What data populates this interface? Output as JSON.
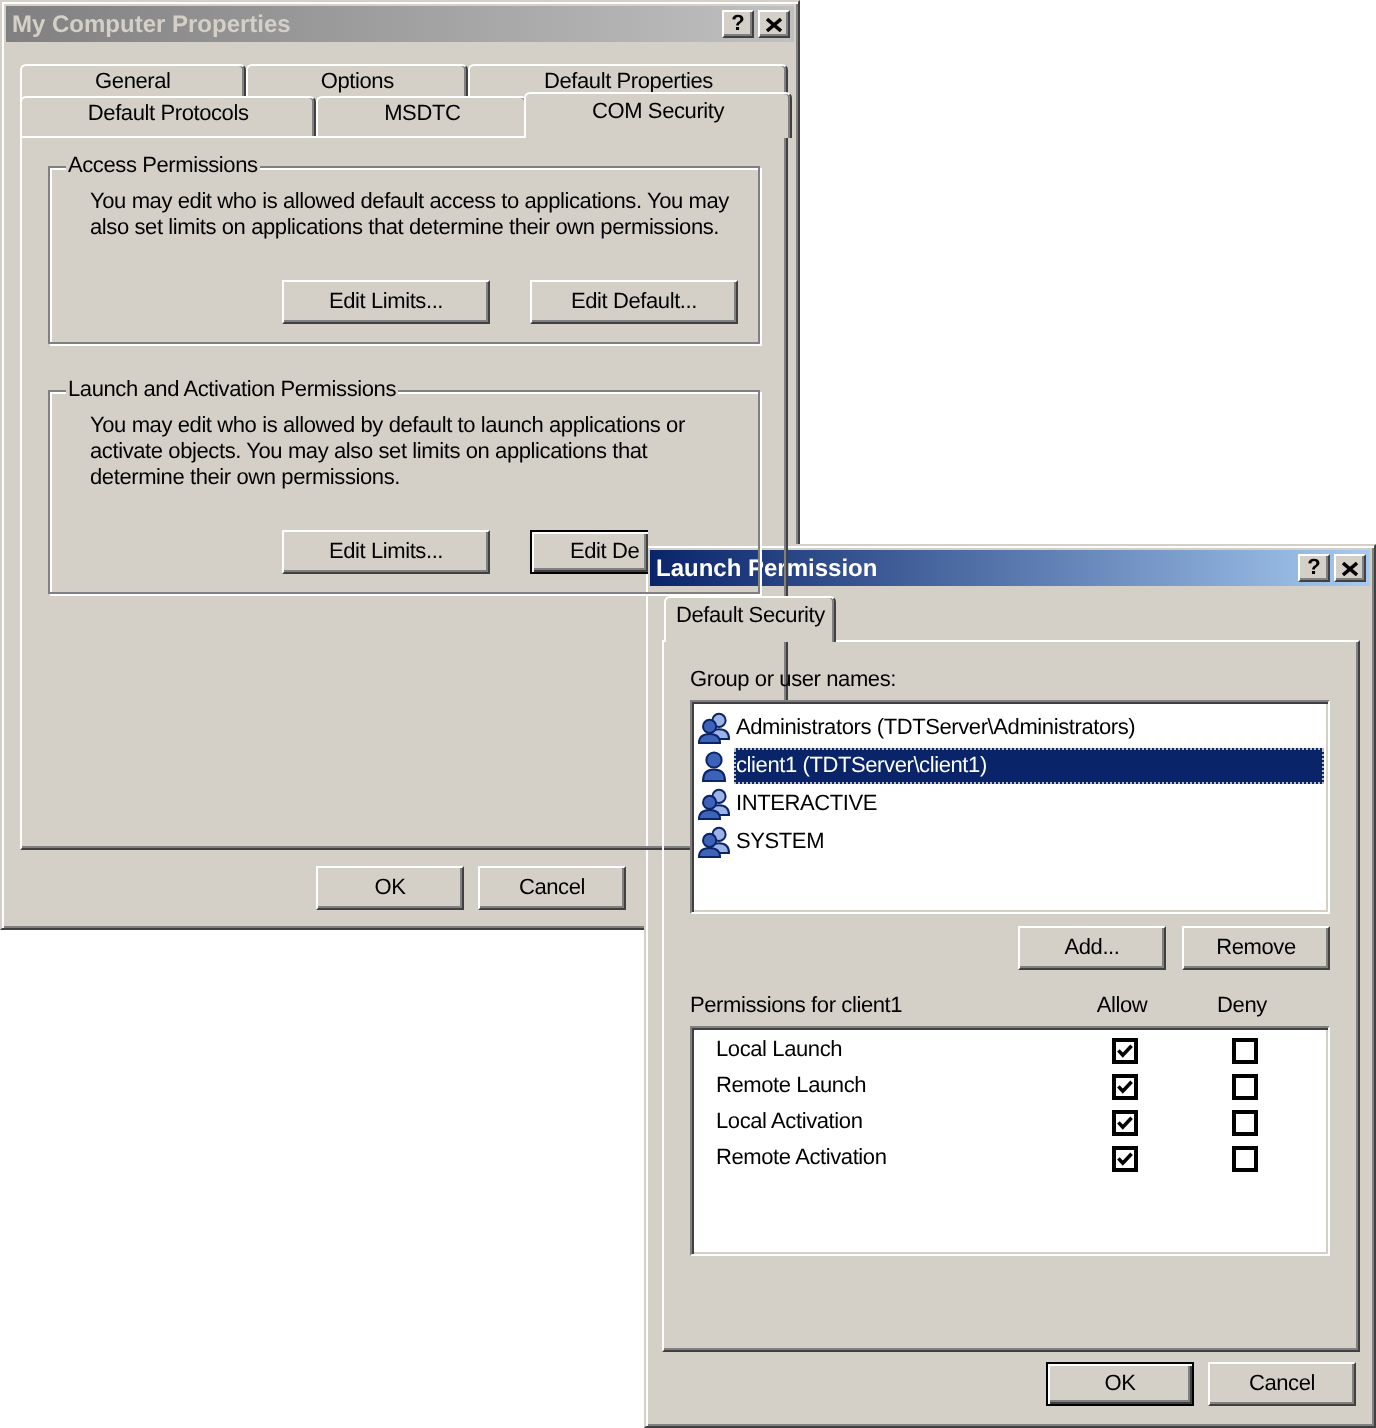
{
  "properties_window": {
    "title": "My Computer Properties",
    "active": false,
    "help_button": "?",
    "tab_rows": [
      [
        {
          "label": "General",
          "selected": false
        },
        {
          "label": "Options",
          "selected": false
        },
        {
          "label": "Default Properties",
          "selected": false
        }
      ],
      [
        {
          "label": "Default Protocols",
          "selected": false
        },
        {
          "label": "MSDTC",
          "selected": false
        },
        {
          "label": "COM Security",
          "selected": true
        }
      ]
    ],
    "groups": [
      {
        "legend": "Access Permissions",
        "text": "You may edit who is allowed default access to applications. You may also set limits on applications that determine their own permissions.",
        "buttons": [
          {
            "label": "Edit Limits...",
            "default": false
          },
          {
            "label": "Edit Default...",
            "default": false
          }
        ]
      },
      {
        "legend": "Launch and Activation Permissions",
        "text": "You may edit who is allowed by default to launch applications or activate objects. You may also set limits on applications that determine their own permissions.",
        "buttons": [
          {
            "label": "Edit Limits...",
            "default": false
          },
          {
            "label": "Edit De",
            "default": true,
            "partly_covered": true
          }
        ]
      }
    ],
    "buttons": [
      {
        "label": "OK",
        "default": false
      },
      {
        "label": "Cancel",
        "default": false
      }
    ]
  },
  "launch_window": {
    "title": "Launch Permission",
    "active": true,
    "help_button": "?",
    "tabs": [
      {
        "label": "Default Security",
        "selected": true
      }
    ],
    "users_label": "Group or user names:",
    "users": [
      {
        "name": "Administrators (TDTServer\\Administrators)",
        "kind": "group",
        "selected": false
      },
      {
        "name": "client1 (TDTServer\\client1)",
        "kind": "user",
        "selected": true
      },
      {
        "name": "INTERACTIVE",
        "kind": "group",
        "selected": false
      },
      {
        "name": "SYSTEM",
        "kind": "group",
        "selected": false
      }
    ],
    "user_buttons": [
      {
        "label": "Add...",
        "default": false
      },
      {
        "label": "Remove",
        "default": false
      }
    ],
    "permissions_label": "Permissions for client1",
    "permission_columns": [
      "Allow",
      "Deny"
    ],
    "permissions": [
      {
        "name": "Local Launch",
        "allow": true,
        "deny": false
      },
      {
        "name": "Remote Launch",
        "allow": true,
        "deny": false
      },
      {
        "name": "Local Activation",
        "allow": true,
        "deny": false
      },
      {
        "name": "Remote Activation",
        "allow": true,
        "deny": false
      }
    ],
    "buttons": [
      {
        "label": "OK",
        "default": true
      },
      {
        "label": "Cancel",
        "default": false
      }
    ]
  }
}
